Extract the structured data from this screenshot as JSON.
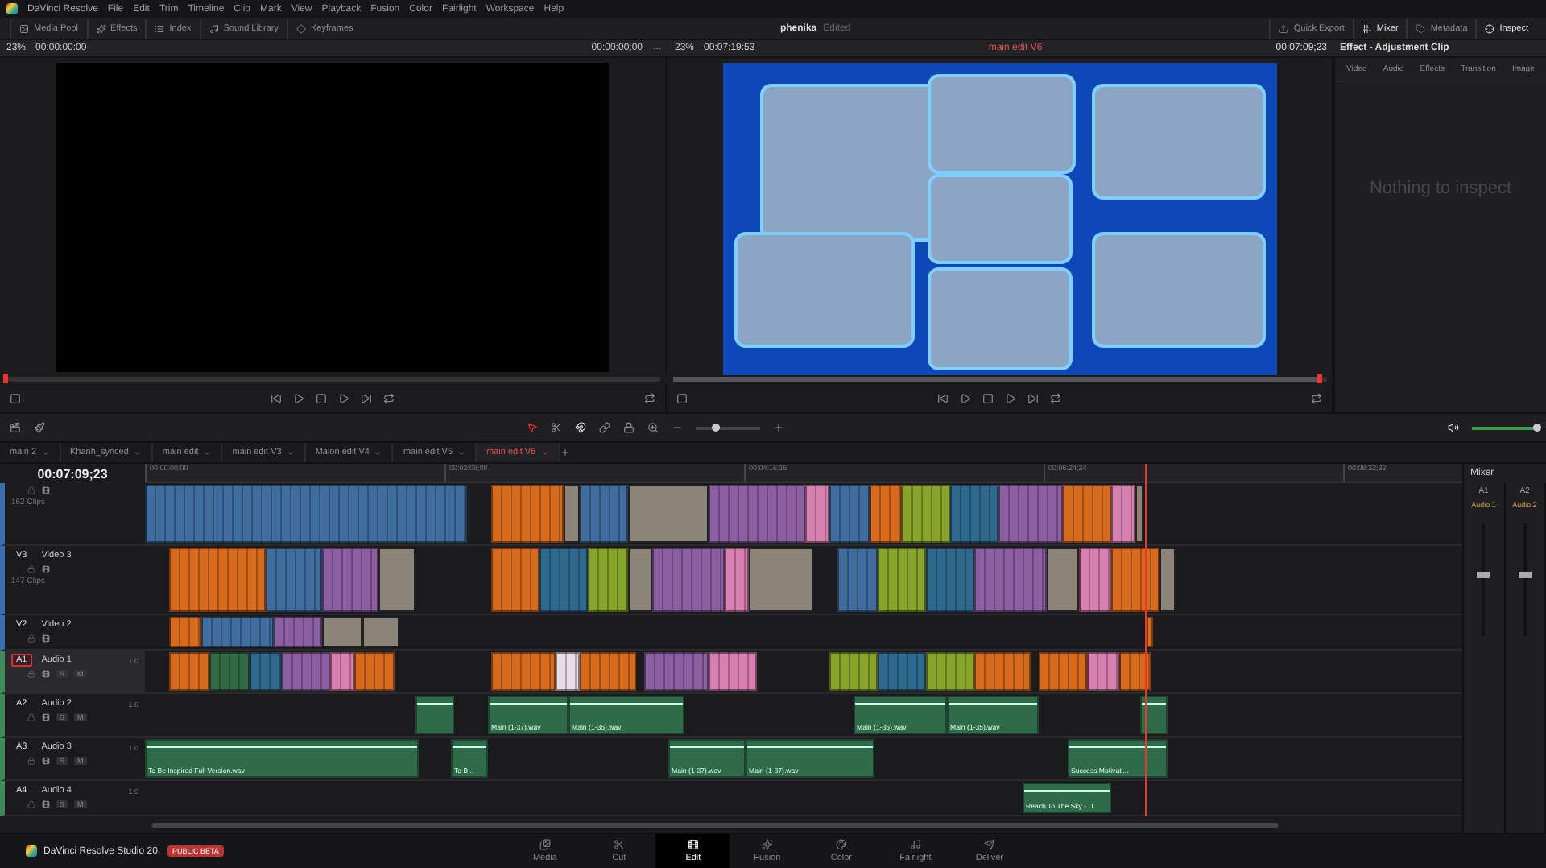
{
  "menu_bar": {
    "app_name": "DaVinci Resolve",
    "items": [
      "File",
      "Edit",
      "Trim",
      "Timeline",
      "Clip",
      "Mark",
      "View",
      "Playback",
      "Fusion",
      "Color",
      "Fairlight",
      "Workspace",
      "Help"
    ]
  },
  "toolbar": {
    "left": [
      {
        "label": "Media Pool"
      },
      {
        "label": "Effects"
      },
      {
        "label": "Index"
      },
      {
        "label": "Sound Library"
      },
      {
        "label": "Keyframes"
      }
    ],
    "project": "phenika",
    "project_status": "Edited",
    "right": [
      {
        "label": "Quick Export",
        "selected": false
      },
      {
        "label": "Mixer",
        "selected": true
      },
      {
        "label": "Metadata",
        "selected": false
      },
      {
        "label": "Inspect",
        "selected": true
      }
    ]
  },
  "source_viewer": {
    "zoom": "23%",
    "timecode": "00:00:00:00",
    "end_timecode": "00:00:00;00",
    "scrubber": {
      "level": 0
    }
  },
  "timeline_viewer": {
    "zoom": "23%",
    "duration": "00:07:19:53",
    "timeline_name": "main edit V6",
    "timecode": "00:07:09;23",
    "scrubber": {
      "level": 0.99
    }
  },
  "inspector": {
    "title": "Effect - Adjustment Clip",
    "tabs": [
      {
        "label": "Video",
        "disabled": true
      },
      {
        "label": "Audio",
        "disabled": true
      },
      {
        "label": "Effects",
        "disabled": true
      },
      {
        "label": "Transition",
        "disabled": true
      },
      {
        "label": "Image",
        "disabled": true
      }
    ],
    "empty_message": "Nothing to inspect"
  },
  "timeline_toolbar": {
    "zoom_slider": {
      "level": 0.3
    },
    "volume_slider": {
      "level": 1
    }
  },
  "timeline_tabs": [
    {
      "label": "main 2",
      "selected": false
    },
    {
      "label": "Khanh_synced",
      "selected": false
    },
    {
      "label": "main edit",
      "selected": false
    },
    {
      "label": "main edit V3",
      "selected": false
    },
    {
      "label": "Maion edit V4",
      "selected": false
    },
    {
      "label": "main edit V5",
      "selected": false
    },
    {
      "label": "main edit V6",
      "selected": true
    }
  ],
  "timeline": {
    "timecode": "00:07:09;23",
    "ruler": [
      "00:00:00;00",
      "00:02:08;08",
      "00:04:16;16",
      "00:06:24;24",
      "00:08:32;32"
    ],
    "tracks": [
      {
        "kind": "video",
        "clip_count": "162 Clips",
        "selected": false,
        "clips": [
          {
            "kind": "clip",
            "color": "#3f6e9e"
          },
          {
            "kind": "gap"
          },
          {
            "kind": "clip",
            "color": "#d86a1e"
          },
          {
            "kind": "photo"
          },
          {
            "kind": "clip",
            "color": "#3f6e9e"
          },
          {
            "kind": "photo"
          },
          {
            "kind": "clip",
            "color": "#8c5fa3"
          },
          {
            "kind": "clip",
            "color": "#d77fb0"
          },
          {
            "kind": "clip",
            "color": "#3f6e9e"
          },
          {
            "kind": "clip",
            "color": "#d86a1e"
          },
          {
            "kind": "clip",
            "color": "#86a52a"
          },
          {
            "kind": "clip",
            "color": "#2f6a8e"
          },
          {
            "kind": "clip",
            "color": "#8c5fa3"
          },
          {
            "kind": "clip",
            "color": "#d86a1e"
          },
          {
            "kind": "clip",
            "color": "#d77fb0"
          },
          {
            "kind": "photo"
          }
        ]
      },
      {
        "kind": "video",
        "id": "V3",
        "name": "Video 3",
        "clip_count": "147 Clips",
        "selected": false,
        "clips": [
          {
            "kind": "gap"
          },
          {
            "kind": "clip",
            "color": "#d86a1e"
          },
          {
            "kind": "clip",
            "color": "#3f6e9e"
          },
          {
            "kind": "clip",
            "color": "#8c5fa3"
          },
          {
            "kind": "photo"
          },
          {
            "kind": "gap"
          },
          {
            "kind": "clip",
            "color": "#d86a1e"
          },
          {
            "kind": "clip",
            "color": "#2f6a8e"
          },
          {
            "kind": "clip",
            "color": "#86a52a"
          },
          {
            "kind": "photo"
          },
          {
            "kind": "clip",
            "color": "#8c5fa3"
          },
          {
            "kind": "clip",
            "color": "#d77fb0"
          },
          {
            "kind": "photo"
          },
          {
            "kind": "gap"
          },
          {
            "kind": "clip",
            "color": "#3f6e9e"
          },
          {
            "kind": "clip",
            "color": "#86a52a"
          },
          {
            "kind": "clip",
            "color": "#2f6a8e"
          },
          {
            "kind": "clip",
            "color": "#8c5fa3"
          },
          {
            "kind": "photo"
          },
          {
            "kind": "clip",
            "color": "#d77fb0"
          },
          {
            "kind": "clip",
            "color": "#d86a1e"
          },
          {
            "kind": "photo"
          }
        ]
      },
      {
        "kind": "video",
        "id": "V2",
        "name": "Video 2",
        "selected": false,
        "clips": [
          {
            "kind": "gap"
          },
          {
            "kind": "clip",
            "color": "#d86a1e"
          },
          {
            "kind": "clip",
            "color": "#3f6e9e"
          },
          {
            "kind": "clip",
            "color": "#8c5fa3"
          },
          {
            "kind": "photo"
          },
          {
            "kind": "photo"
          },
          {
            "kind": "gap"
          },
          {
            "kind": "clip",
            "color": "#d86a1e"
          }
        ]
      },
      {
        "kind": "audio",
        "id": "A1",
        "name": "Audio 1",
        "volume": "1.0",
        "selected": true,
        "buttons": [
          "S",
          "M"
        ],
        "clips": [
          {
            "kind": "gap"
          },
          {
            "kind": "clip",
            "color": "#d86a1e"
          },
          {
            "kind": "clip",
            "color": "#2f6a45"
          },
          {
            "kind": "clip",
            "color": "#2f6a8e"
          },
          {
            "kind": "clip",
            "color": "#8c5fa3"
          },
          {
            "kind": "clip",
            "color": "#d77fb0"
          },
          {
            "kind": "clip",
            "color": "#d86a1e"
          },
          {
            "kind": "gap"
          },
          {
            "kind": "clip",
            "color": "#d86a1e"
          },
          {
            "kind": "clip",
            "color": "#e8dde6"
          },
          {
            "kind": "clip",
            "color": "#d86a1e"
          },
          {
            "kind": "gap"
          },
          {
            "kind": "clip",
            "color": "#8c5fa3"
          },
          {
            "kind": "clip",
            "color": "#d77fb0"
          },
          {
            "kind": "gap"
          },
          {
            "kind": "clip",
            "color": "#86a52a"
          },
          {
            "kind": "clip",
            "color": "#2f6a8e"
          },
          {
            "kind": "clip",
            "color": "#86a52a"
          },
          {
            "kind": "clip",
            "color": "#d86a1e"
          },
          {
            "kind": "gap"
          },
          {
            "kind": "clip",
            "color": "#d86a1e"
          },
          {
            "kind": "clip",
            "color": "#d77fb0"
          },
          {
            "kind": "clip",
            "color": "#d86a1e"
          }
        ]
      },
      {
        "kind": "audio",
        "id": "A2",
        "name": "Audio 2",
        "volume": "1.0",
        "selected": false,
        "buttons": [
          "S",
          "M"
        ],
        "clips": [
          {
            "kind": "gap"
          },
          {
            "kind": "wave"
          },
          {
            "kind": "gap"
          },
          {
            "kind": "wave",
            "label": "Main (1-37).wav"
          },
          {
            "kind": "wave",
            "label": "Main (1-35).wav"
          },
          {
            "kind": "gap"
          },
          {
            "kind": "wave",
            "label": "Main (1-35).wav"
          },
          {
            "kind": "wave",
            "label": "Main (1-35).wav"
          },
          {
            "kind": "gap"
          },
          {
            "kind": "wave"
          }
        ]
      },
      {
        "kind": "audio",
        "id": "A3",
        "name": "Audio 3",
        "volume": "1.0",
        "selected": false,
        "buttons": [
          "S",
          "M"
        ],
        "clips": [
          {
            "kind": "wave",
            "label": "To Be Inspired Full Version.wav"
          },
          {
            "kind": "gap"
          },
          {
            "kind": "wave",
            "label": "To B..."
          },
          {
            "kind": "gap"
          },
          {
            "kind": "wave",
            "label": "Main (1-37).wav"
          },
          {
            "kind": "wave",
            "label": "Main (1-37).wav"
          },
          {
            "kind": "gap"
          },
          {
            "kind": "wave",
            "label": "Success Motivati..."
          }
        ]
      },
      {
        "kind": "audio",
        "id": "A4",
        "name": "Audio 4",
        "volume": "1.0",
        "selected": false,
        "buttons": [
          "S",
          "M"
        ],
        "clips": [
          {
            "kind": "gap"
          },
          {
            "kind": "wave",
            "label": "Reach To The Sky - U"
          }
        ]
      }
    ]
  },
  "mixer": {
    "title": "Mixer",
    "channels": [
      {
        "id": "A1",
        "name": "Audio 1",
        "level": 0.55
      },
      {
        "id": "A2",
        "name": "Audio 2",
        "level": 0.55
      }
    ]
  },
  "page_bar": {
    "product": "DaVinci Resolve Studio 20",
    "badge": "PUBLIC BETA",
    "pages": [
      {
        "label": "Media",
        "selected": false
      },
      {
        "label": "Cut",
        "selected": false
      },
      {
        "label": "Edit",
        "selected": true
      },
      {
        "label": "Fusion",
        "selected": false
      },
      {
        "label": "Color",
        "selected": false
      },
      {
        "label": "Fairlight",
        "selected": false
      },
      {
        "label": "Deliver",
        "selected": false
      }
    ]
  }
}
